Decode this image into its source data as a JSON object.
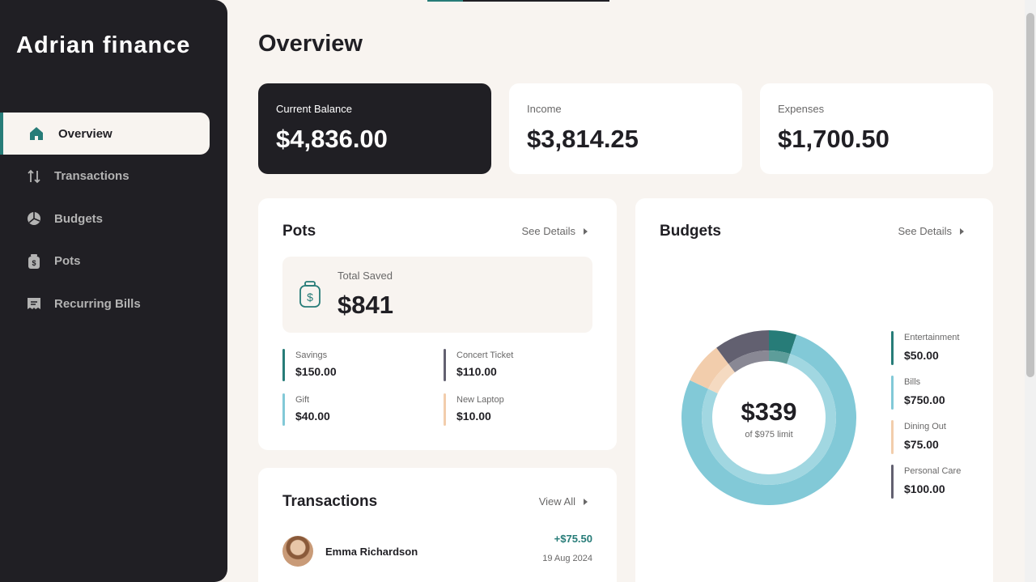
{
  "app": {
    "brand": "Adrian finance"
  },
  "sidebar": {
    "items": [
      {
        "label": "Overview",
        "icon": "home-icon",
        "active": true
      },
      {
        "label": "Transactions",
        "icon": "arrows-updown-icon",
        "active": false
      },
      {
        "label": "Budgets",
        "icon": "pie-chart-icon",
        "active": false
      },
      {
        "label": "Pots",
        "icon": "jar-icon",
        "active": false
      },
      {
        "label": "Recurring Bills",
        "icon": "receipt-icon",
        "active": false
      }
    ]
  },
  "main": {
    "title": "Overview",
    "summary": {
      "balance": {
        "label": "Current Balance",
        "value": "$4,836.00"
      },
      "income": {
        "label": "Income",
        "value": "$3,814.25"
      },
      "expenses": {
        "label": "Expenses",
        "value": "$1,700.50"
      }
    },
    "pots": {
      "title": "Pots",
      "link": "See Details",
      "total_label": "Total Saved",
      "total_value": "$841",
      "items": [
        {
          "name": "Savings",
          "value": "$150.00",
          "color": "#277C78"
        },
        {
          "name": "Concert Ticket",
          "value": "$110.00",
          "color": "#626070"
        },
        {
          "name": "Gift",
          "value": "$40.00",
          "color": "#82C9D7"
        },
        {
          "name": "New Laptop",
          "value": "$10.00",
          "color": "#F2CDAC"
        }
      ]
    },
    "transactions": {
      "title": "Transactions",
      "link": "View All",
      "rows": [
        {
          "name": "Emma Richardson",
          "amount": "+$75.50",
          "date": "19 Aug 2024"
        }
      ]
    },
    "budgets": {
      "title": "Budgets",
      "link": "See Details",
      "spent": "$339",
      "limit_text": "of $975 limit",
      "items": [
        {
          "name": "Entertainment",
          "value": "$50.00",
          "color": "#277C78"
        },
        {
          "name": "Bills",
          "value": "$750.00",
          "color": "#82C9D7"
        },
        {
          "name": "Dining Out",
          "value": "$75.00",
          "color": "#F2CDAC"
        },
        {
          "name": "Personal Care",
          "value": "$100.00",
          "color": "#626070"
        }
      ]
    }
  },
  "chart_data": {
    "type": "pie",
    "categories": [
      "Entertainment",
      "Bills",
      "Dining Out",
      "Personal Care"
    ],
    "values": [
      50,
      750,
      75,
      100
    ],
    "colors": [
      "#277C78",
      "#82C9D7",
      "#F2CDAC",
      "#626070"
    ]
  }
}
